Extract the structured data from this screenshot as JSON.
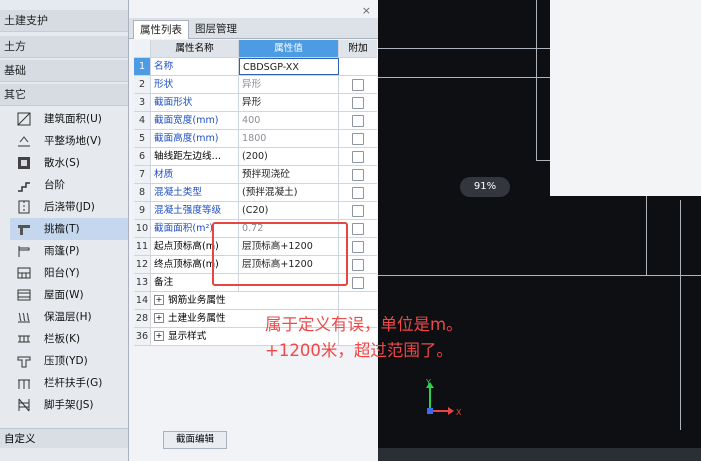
{
  "left_nav": {
    "categories": [
      "土建支护",
      "土方",
      "基础",
      "其它"
    ],
    "items": [
      {
        "label": "建筑面积(U)",
        "icon": "area-icon"
      },
      {
        "label": "平整场地(V)",
        "icon": "site-level-icon"
      },
      {
        "label": "散水(S)",
        "icon": "apron-icon"
      },
      {
        "label": "台阶",
        "icon": "steps-icon"
      },
      {
        "label": "后浇带(JD)",
        "icon": "post-cast-icon"
      },
      {
        "label": "挑檐(T)",
        "icon": "eave-icon",
        "selected": true
      },
      {
        "label": "雨篷(P)",
        "icon": "canopy-icon"
      },
      {
        "label": "阳台(Y)",
        "icon": "balcony-icon"
      },
      {
        "label": "屋面(W)",
        "icon": "roof-icon"
      },
      {
        "label": "保温层(H)",
        "icon": "insulation-icon"
      },
      {
        "label": "栏板(K)",
        "icon": "parapet-icon"
      },
      {
        "label": "压顶(YD)",
        "icon": "coping-icon"
      },
      {
        "label": "栏杆扶手(G)",
        "icon": "railing-icon"
      },
      {
        "label": "脚手架(JS)",
        "icon": "scaffold-icon"
      }
    ],
    "footer": "自定义"
  },
  "panel": {
    "tabs": [
      "属性列表",
      "图层管理"
    ],
    "headers": {
      "num": "",
      "name": "属性名称",
      "value": "属性值",
      "extra": "附加"
    },
    "rows": [
      {
        "num": "1",
        "name": "名称",
        "value": "CBDSGP-XX",
        "blue": true,
        "checkbox": false,
        "selected": true
      },
      {
        "num": "2",
        "name": "形状",
        "value": "异形",
        "blue": true,
        "checkbox": true,
        "dim": true
      },
      {
        "num": "3",
        "name": "截面形状",
        "value": "异形",
        "blue": true,
        "checkbox": true
      },
      {
        "num": "4",
        "name": "截面宽度(mm)",
        "value": "400",
        "blue": true,
        "checkbox": true,
        "dim": true
      },
      {
        "num": "5",
        "name": "截面高度(mm)",
        "value": "1800",
        "blue": true,
        "checkbox": true,
        "dim": true
      },
      {
        "num": "6",
        "name": "轴线距左边线…",
        "value": "(200)",
        "blue": false,
        "checkbox": true
      },
      {
        "num": "7",
        "name": "材质",
        "value": "预拌现浇砼",
        "blue": true,
        "checkbox": true
      },
      {
        "num": "8",
        "name": "混凝土类型",
        "value": "(预拌混凝土)",
        "blue": true,
        "checkbox": true
      },
      {
        "num": "9",
        "name": "混凝土强度等级",
        "value": "(C20)",
        "blue": true,
        "checkbox": true
      },
      {
        "num": "10",
        "name": "截面面积(m²)",
        "value": "0.72",
        "blue": true,
        "checkbox": true,
        "dim": true
      },
      {
        "num": "11",
        "name": "起点顶标高(m)",
        "value": "层顶标高+1200",
        "blue": false,
        "checkbox": true
      },
      {
        "num": "12",
        "name": "终点顶标高(m)",
        "value": "层顶标高+1200",
        "blue": false,
        "checkbox": true
      },
      {
        "num": "13",
        "name": "备注",
        "value": "",
        "blue": false,
        "checkbox": true
      }
    ],
    "groups": [
      {
        "num": "14",
        "label": "钢筋业务属性"
      },
      {
        "num": "28",
        "label": "土建业务属性"
      },
      {
        "num": "36",
        "label": "显示样式"
      }
    ],
    "edit_button": "截面编辑",
    "close": "×"
  },
  "zoom": "91%",
  "annotation": {
    "line1": "属于定义有误，单位是m。",
    "line2": "+1200米，超过范围了。",
    "color": "#f04848"
  },
  "axis": {
    "x": "X",
    "y": "Y"
  }
}
